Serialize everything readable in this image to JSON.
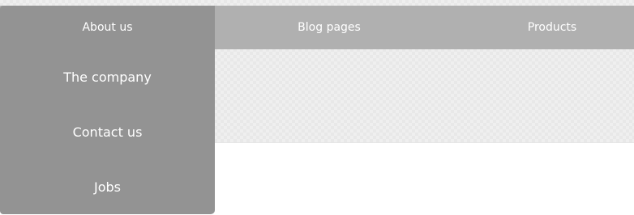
{
  "nav": {
    "items": [
      {
        "label": "About us"
      },
      {
        "label": "Blog pages"
      },
      {
        "label": "Products"
      }
    ]
  },
  "dropdown": {
    "items": [
      {
        "label": "The company"
      },
      {
        "label": "Contact us"
      },
      {
        "label": "Jobs"
      }
    ]
  },
  "colors": {
    "navbar_bg": "#b0b0b0",
    "active_bg": "#939393",
    "text": "#ffffff",
    "pattern_bg": "#efefef"
  }
}
